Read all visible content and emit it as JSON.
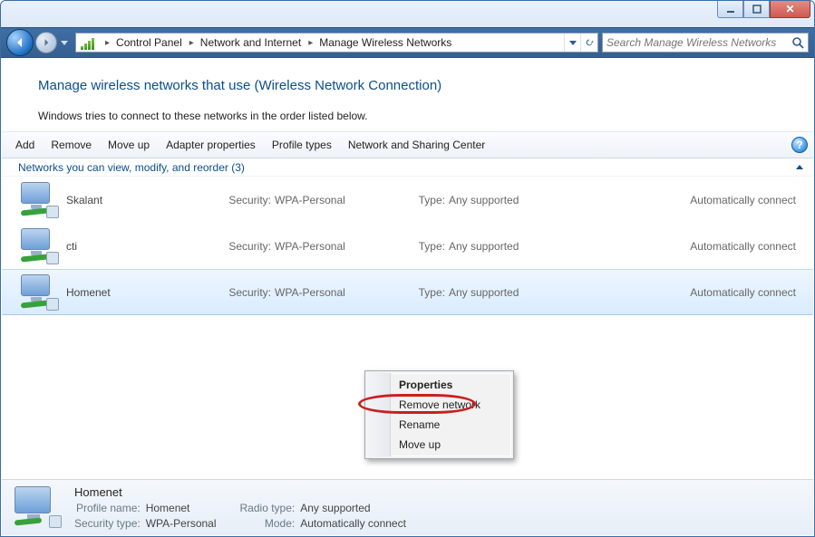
{
  "window": {
    "tabs": [
      "",
      "",
      "",
      "",
      "",
      ""
    ]
  },
  "breadcrumb": {
    "items": [
      "Control Panel",
      "Network and Internet",
      "Manage Wireless Networks"
    ]
  },
  "search": {
    "placeholder": "Search Manage Wireless Networks"
  },
  "header": {
    "title": "Manage wireless networks that use (Wireless Network Connection)",
    "subtitle": "Windows tries to connect to these networks in the order listed below."
  },
  "toolbar": {
    "items": [
      "Add",
      "Remove",
      "Move up",
      "Adapter properties",
      "Profile types",
      "Network and Sharing Center"
    ]
  },
  "group": {
    "label": "Networks you can view, modify, and reorder (3)"
  },
  "labels": {
    "security": "Security:",
    "type": "Type:"
  },
  "networks": [
    {
      "name": "Skalant",
      "security": "WPA-Personal",
      "type": "Any supported",
      "connect": "Automatically connect",
      "selected": false
    },
    {
      "name": "cti",
      "security": "WPA-Personal",
      "type": "Any supported",
      "connect": "Automatically connect",
      "selected": false
    },
    {
      "name": "Homenet",
      "security": "WPA-Personal",
      "type": "Any supported",
      "connect": "Automatically connect",
      "selected": true
    }
  ],
  "context_menu": {
    "items": [
      {
        "label": "Properties",
        "bold": true
      },
      {
        "label": "Remove network",
        "highlighted": true
      },
      {
        "label": "Rename"
      },
      {
        "label": "Move up"
      }
    ]
  },
  "details": {
    "title": "Homenet",
    "profile_name_label": "Profile name:",
    "profile_name": "Homenet",
    "security_type_label": "Security type:",
    "security_type": "WPA-Personal",
    "radio_type_label": "Radio type:",
    "radio_type": "Any supported",
    "mode_label": "Mode:",
    "mode": "Automatically connect"
  }
}
